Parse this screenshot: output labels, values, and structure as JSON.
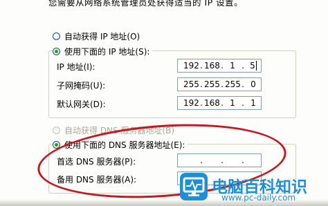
{
  "intro_text": "您需要从网络系统管理员处获得适当的 IP 设置。",
  "ip_section": {
    "auto_label": "自动获得 IP 地址(O)",
    "manual_label": "使用下面的 IP 地址(S):",
    "auto_checked": false,
    "manual_checked": true,
    "fields": [
      {
        "label": "IP 地址(I):",
        "octets": [
          "192",
          "168",
          "1",
          "5"
        ]
      },
      {
        "label": "子网掩码(U):",
        "octets": [
          "255",
          "255",
          "255",
          "0"
        ]
      },
      {
        "label": "默认网关(D):",
        "octets": [
          "192",
          "168",
          "1",
          "1"
        ]
      }
    ]
  },
  "dns_section": {
    "auto_label": "自动获得 DNS 服务器地址(B)",
    "auto_enabled": false,
    "manual_label": "使用下面的 DNS 服务器地址(E):",
    "manual_checked": true,
    "fields": [
      {
        "label": "首选 DNS 服务器(P):",
        "octets": [
          "",
          "",
          "",
          ""
        ]
      },
      {
        "label": "备用 DNS 服务器(A):",
        "octets": [
          "",
          "",
          "",
          ""
        ]
      }
    ]
  },
  "watermark": {
    "title": "电脑百科知识",
    "url": "www.pc-daily.com"
  },
  "colors": {
    "accent_brand": "#1d8fd6",
    "highlight_ellipse": "#c8161d",
    "radio_checked": "#21a121"
  }
}
